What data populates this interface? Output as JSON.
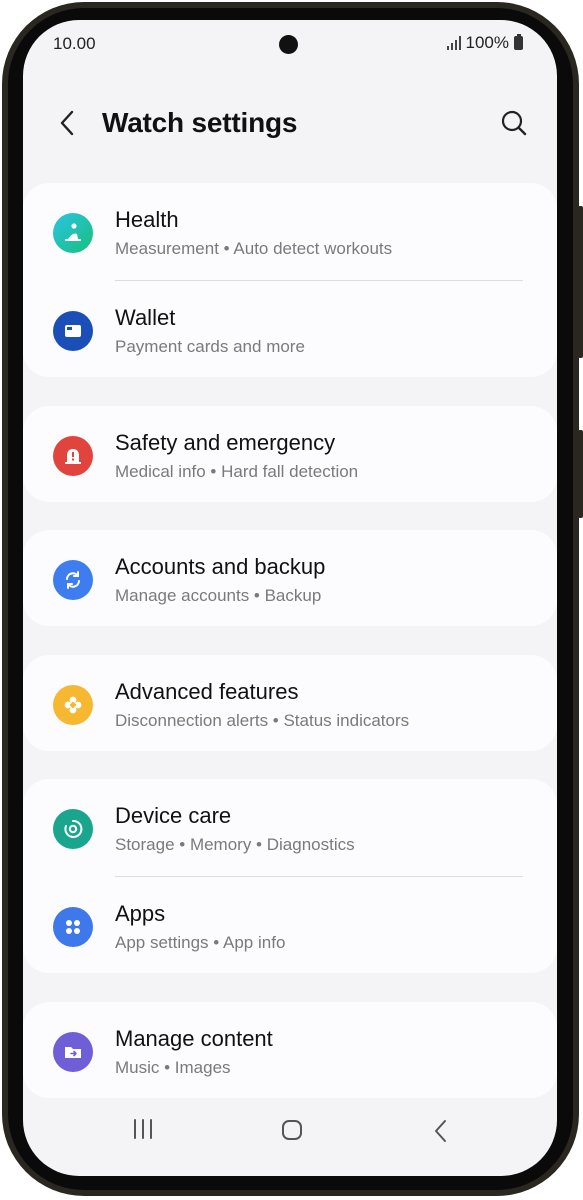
{
  "status_bar": {
    "time": "10.00",
    "battery": "100%"
  },
  "header": {
    "title": "Watch settings"
  },
  "groups": [
    {
      "items": [
        {
          "label": "Health",
          "sub": "Measurement • Auto detect workouts",
          "icon": "health-icon",
          "color": "#1bbd9a"
        },
        {
          "label": "Wallet",
          "sub": "Payment cards and more",
          "icon": "wallet-icon",
          "color": "#1a4fb8"
        }
      ]
    },
    {
      "items": [
        {
          "label": "Safety and emergency",
          "sub": "Medical info • Hard fall detection",
          "icon": "safety-icon",
          "color": "#e0443d"
        }
      ]
    },
    {
      "items": [
        {
          "label": "Accounts and backup",
          "sub": "Manage accounts • Backup",
          "icon": "sync-icon",
          "color": "#3d7df0"
        }
      ]
    },
    {
      "items": [
        {
          "label": "Advanced features",
          "sub": "Disconnection alerts • Status indicators",
          "icon": "advanced-features-icon",
          "color": "#f6b731"
        }
      ]
    },
    {
      "items": [
        {
          "label": "Device care",
          "sub": "Storage • Memory • Diagnostics",
          "icon": "device-care-icon",
          "color": "#1aa58f"
        },
        {
          "label": "Apps",
          "sub": "App settings • App info",
          "icon": "apps-icon",
          "color": "#3e78ea"
        }
      ]
    },
    {
      "items": [
        {
          "label": "Manage content",
          "sub": "Music • Images",
          "icon": "folder-icon",
          "color": "#6f5fd6"
        }
      ]
    }
  ]
}
